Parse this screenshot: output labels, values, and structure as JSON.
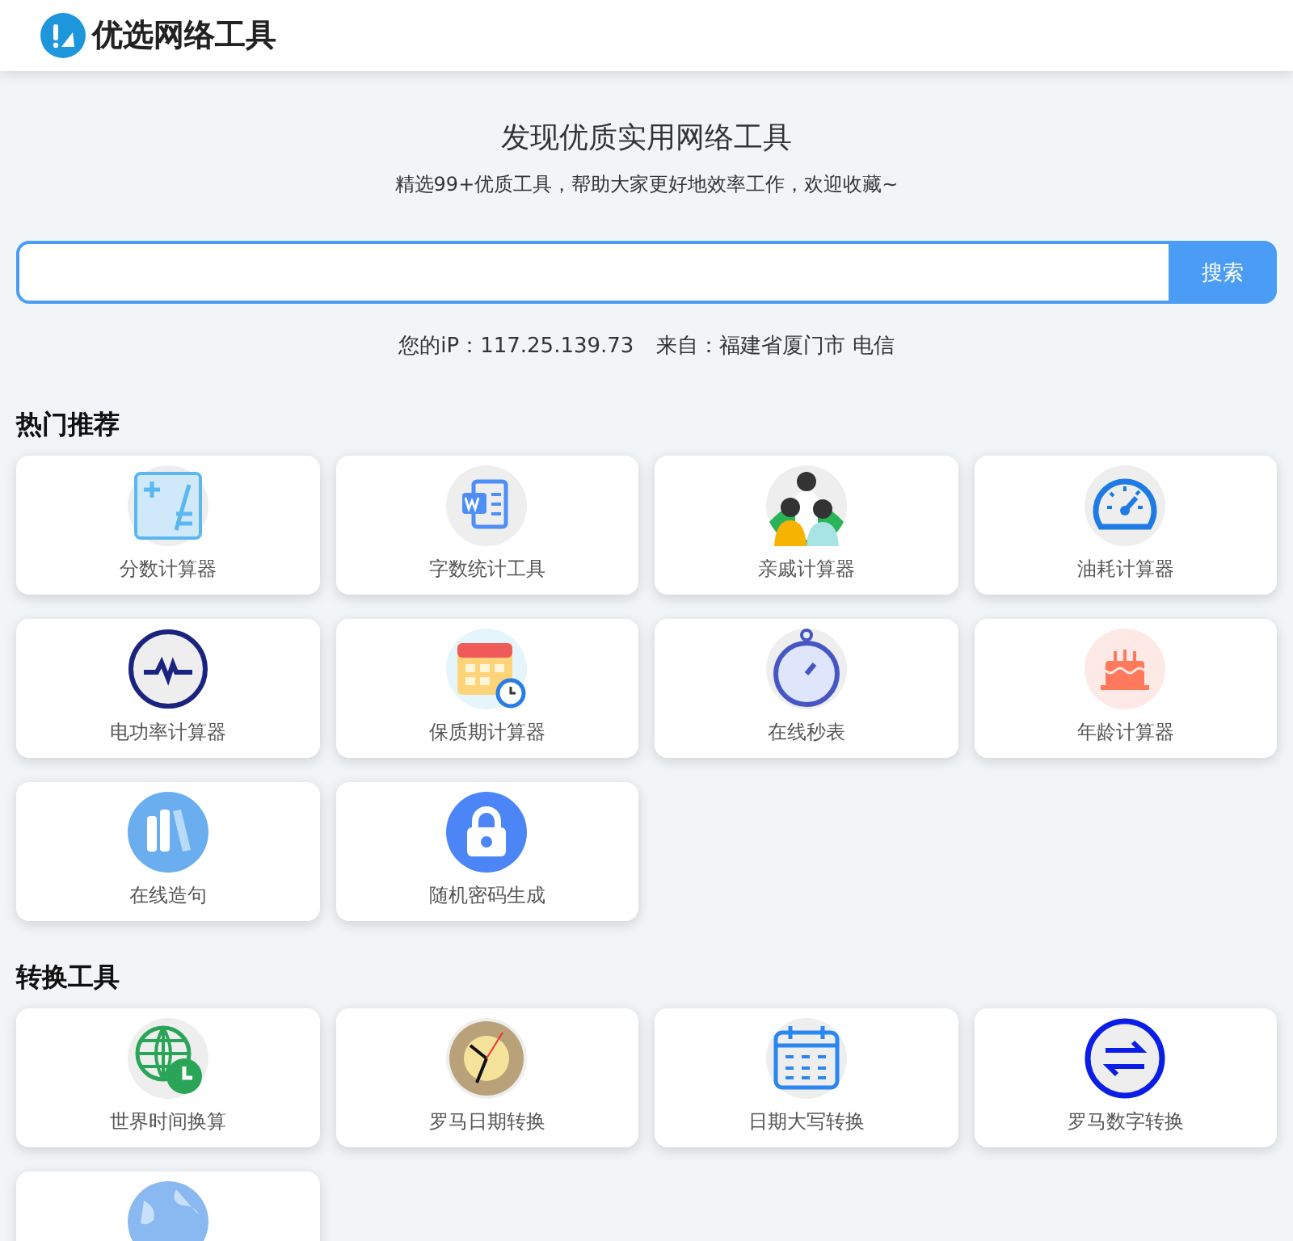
{
  "brand": {
    "name": "优选网络工具"
  },
  "hero": {
    "title": "发现优质实用网络工具",
    "subtitle": "精选99+优质工具，帮助大家更好地效率工作，欢迎收藏~"
  },
  "search": {
    "button": "搜索"
  },
  "ip_info": {
    "ip_label": "您的iP：117.25.139.73",
    "from_label": "来自：福建省厦门市 电信"
  },
  "sections": [
    {
      "title": "热门推荐",
      "tools": [
        {
          "kind": "tool",
          "label": "分数计算器"
        },
        {
          "kind": "tool",
          "label": "字数统计工具"
        },
        {
          "kind": "tool",
          "label": "亲戚计算器"
        },
        {
          "kind": "tool",
          "label": "油耗计算器"
        },
        {
          "kind": "tool",
          "label": "电功率计算器"
        },
        {
          "kind": "tool",
          "label": "保质期计算器"
        },
        {
          "kind": "tool",
          "label": "在线秒表"
        },
        {
          "kind": "tool",
          "label": "年龄计算器"
        },
        {
          "kind": "tool",
          "label": "在线造句"
        },
        {
          "kind": "tool",
          "label": "随机密码生成"
        }
      ]
    },
    {
      "title": "转换工具",
      "tools": [
        {
          "kind": "tool",
          "label": "世界时间换算"
        },
        {
          "kind": "tool",
          "label": "罗马日期转换"
        },
        {
          "kind": "tool",
          "label": "日期大写转换"
        },
        {
          "kind": "tool",
          "label": "罗马数字转换"
        },
        {
          "kind": "cut-off"
        }
      ]
    }
  ]
}
